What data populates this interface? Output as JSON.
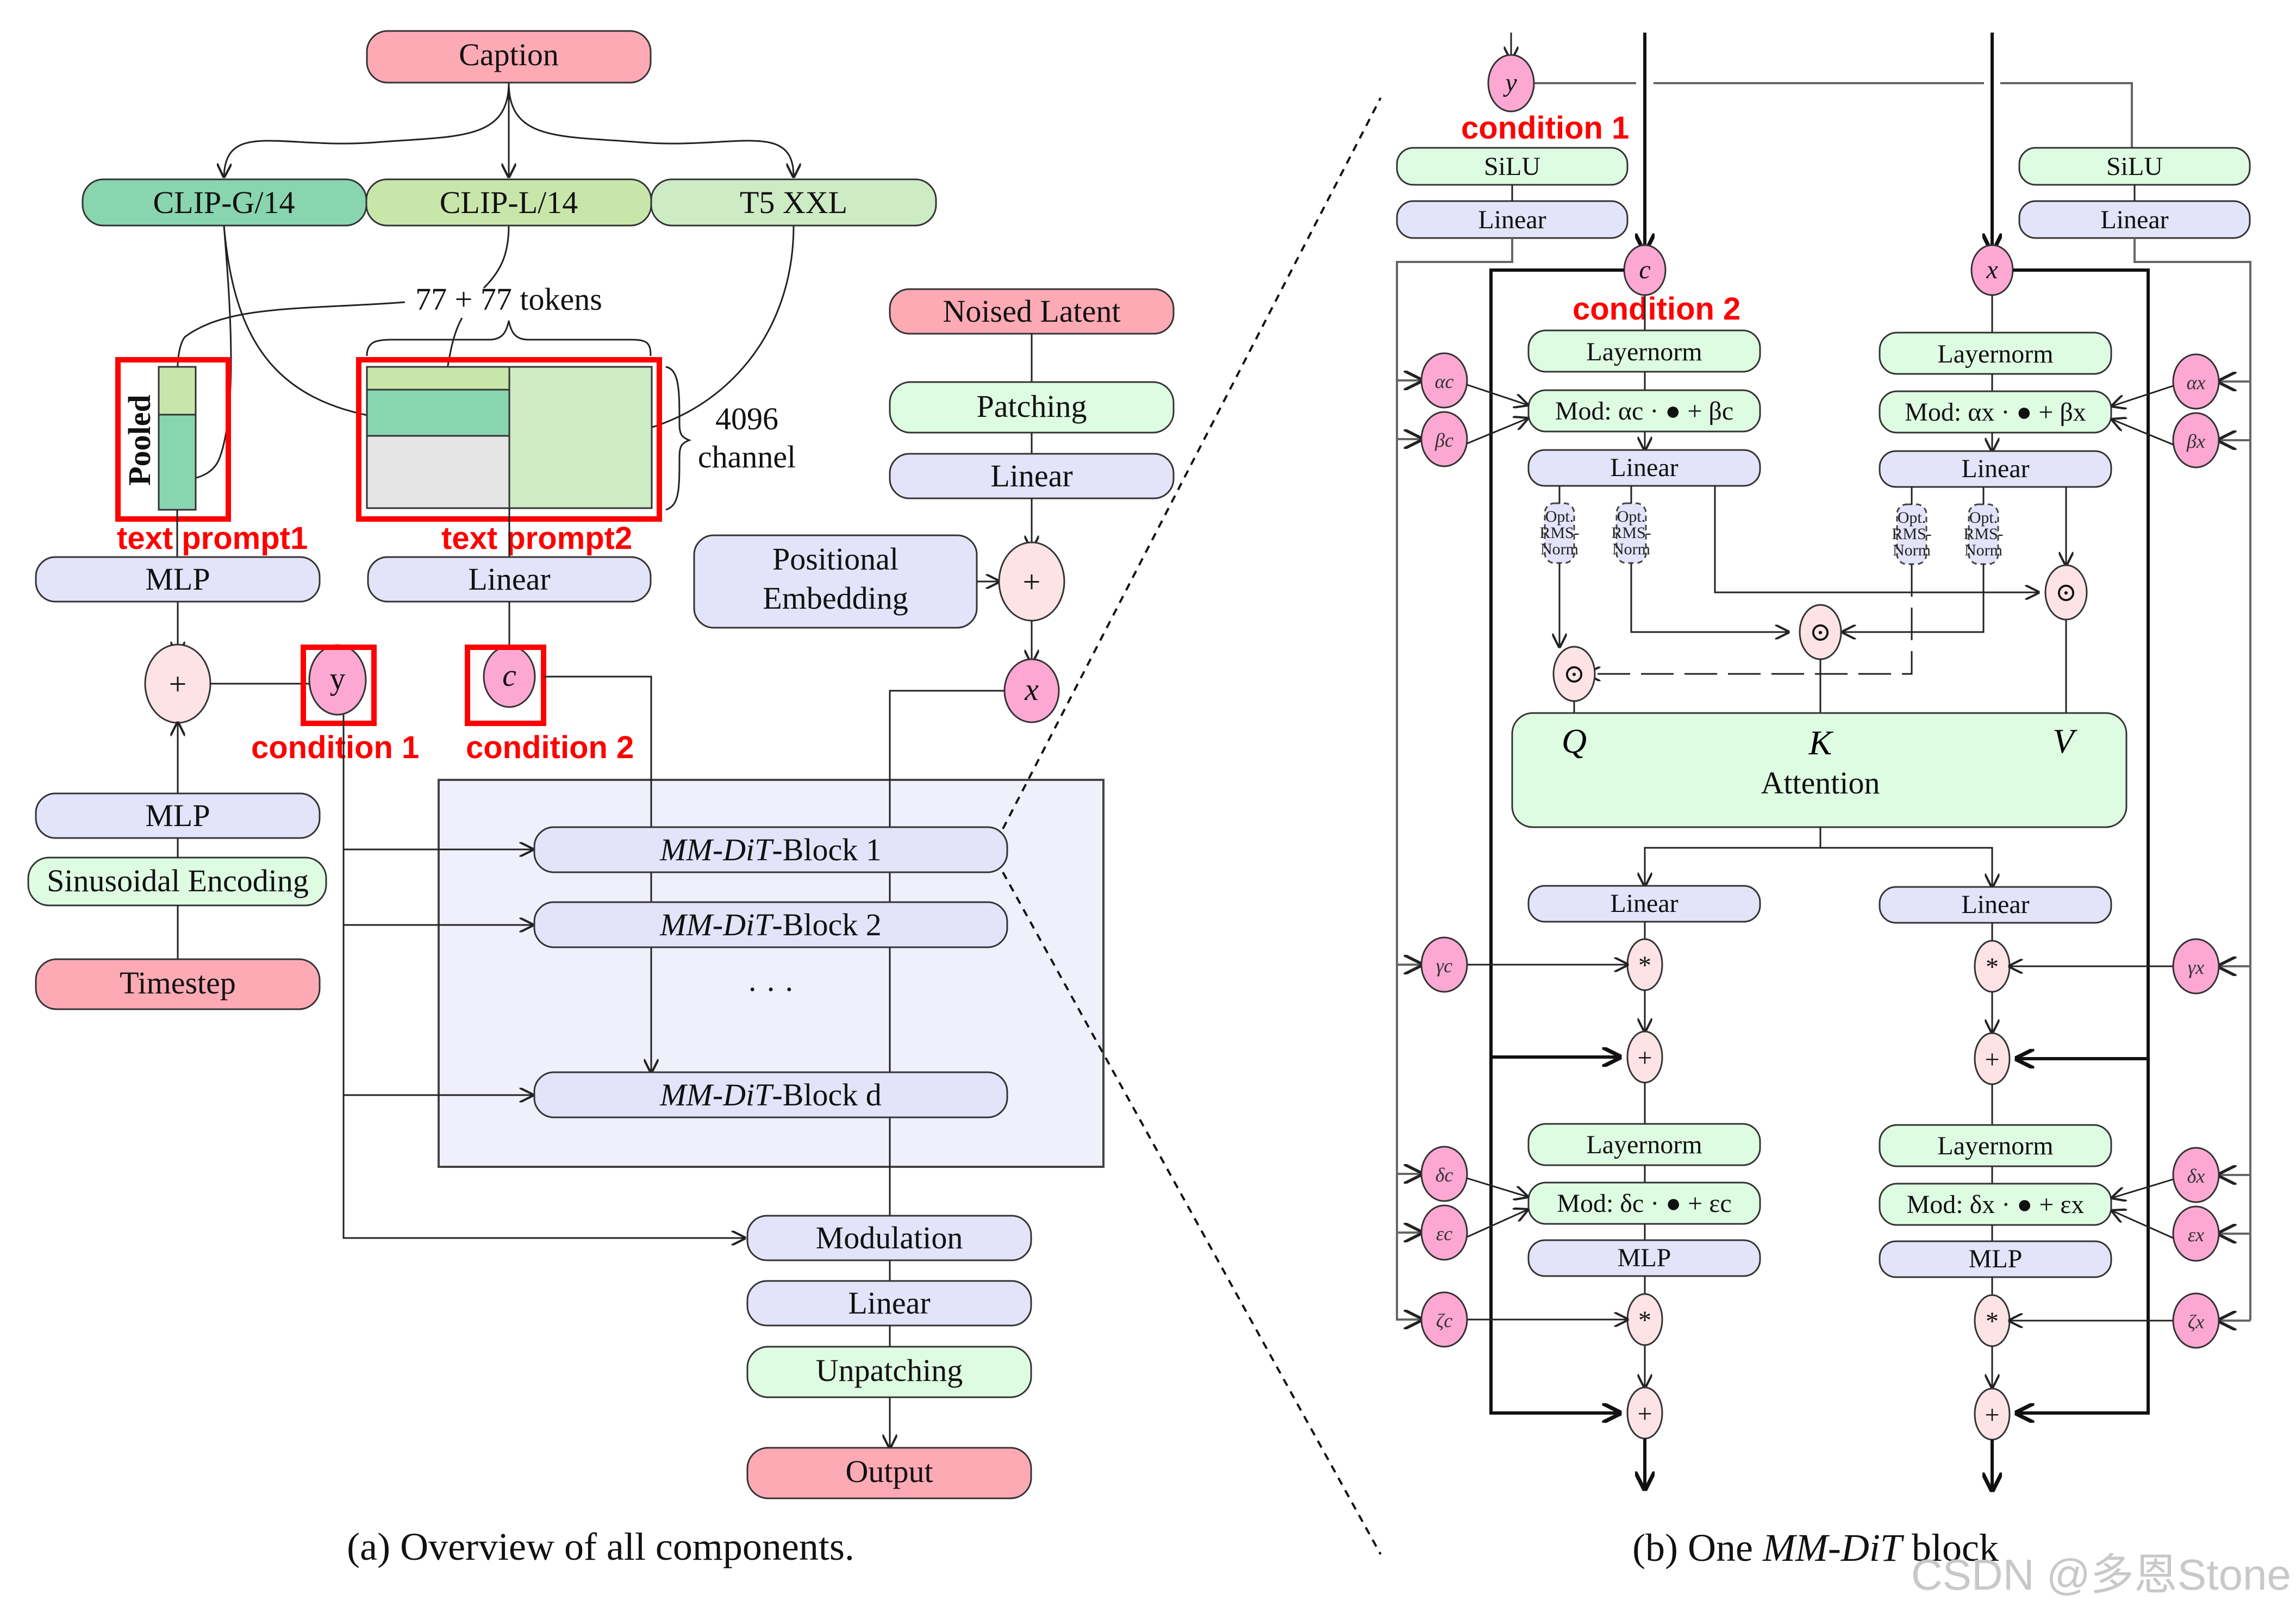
{
  "colors": {
    "pink_input": "#fdaab5",
    "clip_g": "#88d5b0",
    "clip_l": "#c8e6aa",
    "t5": "#cdebc4",
    "light_green": "#defce2",
    "lavender": "#e3e3fa",
    "op_circle": "#fde3e6",
    "var_circle": "#fda8d2",
    "panel_bg": "#f0f0fd",
    "gray_block": "#e5e5e5",
    "annotation_red": "#ff0000"
  },
  "left_panel": {
    "caption_node": "Caption",
    "encoders": [
      "CLIP-G/14",
      "CLIP-L/14",
      "T5 XXL"
    ],
    "tokens_label": "77 + 77 tokens",
    "channel_label_1": "4096",
    "channel_label_2": "channel",
    "pooled_label": "Pooled",
    "annotation_text_prompt1": "text prompt1",
    "annotation_text_prompt2": "text prompt2",
    "mlp_top": "MLP",
    "linear_text": "Linear",
    "plus_symbol": "+",
    "y_symbol": "y",
    "c_symbol": "c",
    "annotation_condition1": "condition 1",
    "annotation_condition2": "condition 2",
    "mlp_time": "MLP",
    "sinusoidal": "Sinusoidal Encoding",
    "timestep": "Timestep",
    "noised_latent": "Noised Latent",
    "patching": "Patching",
    "linear_latent": "Linear",
    "positional_embedding_1": "Positional",
    "positional_embedding_2": "Embedding",
    "x_symbol": "x",
    "blocks": [
      {
        "italic": "MM-DiT",
        "rest": "-Block 1"
      },
      {
        "italic": "MM-DiT",
        "rest": "-Block 2"
      },
      {
        "italic": "MM-DiT",
        "rest": "-Block d"
      }
    ],
    "ellipsis": "· · ·",
    "modulation": "Modulation",
    "linear_out": "Linear",
    "unpatching": "Unpatching",
    "output": "Output",
    "caption": "(a) Overview of all components."
  },
  "right_panel": {
    "y_symbol": "y",
    "c_symbol": "c",
    "x_symbol": "x",
    "annotation_condition1": "condition 1",
    "annotation_condition2": "condition 2",
    "silu": "SiLU",
    "linear": "Linear",
    "layernorm": "Layernorm",
    "mod_c_1": "Mod: αc · ● + βc",
    "mod_x_1": "Mod: αx · ● + βx",
    "mod_c_2": "Mod: δc · ● + εc",
    "mod_x_2": "Mod: δx · ● + εx",
    "opt_rms": [
      "Opt.",
      "RMS-",
      "Norm"
    ],
    "odot": "⊙",
    "attention": "Attention",
    "q": "Q",
    "k": "K",
    "v": "V",
    "mlp": "MLP",
    "times": "*",
    "plus": "+",
    "vars_c": [
      "αc",
      "βc",
      "γc",
      "δc",
      "εc",
      "ζc"
    ],
    "vars_x": [
      "αx",
      "βx",
      "γx",
      "δx",
      "εx",
      "ζx"
    ],
    "caption_prefix": "(b) One ",
    "caption_italic": "MM-DiT",
    "caption_suffix": " block"
  },
  "watermark": "CSDN @多恩Stone"
}
